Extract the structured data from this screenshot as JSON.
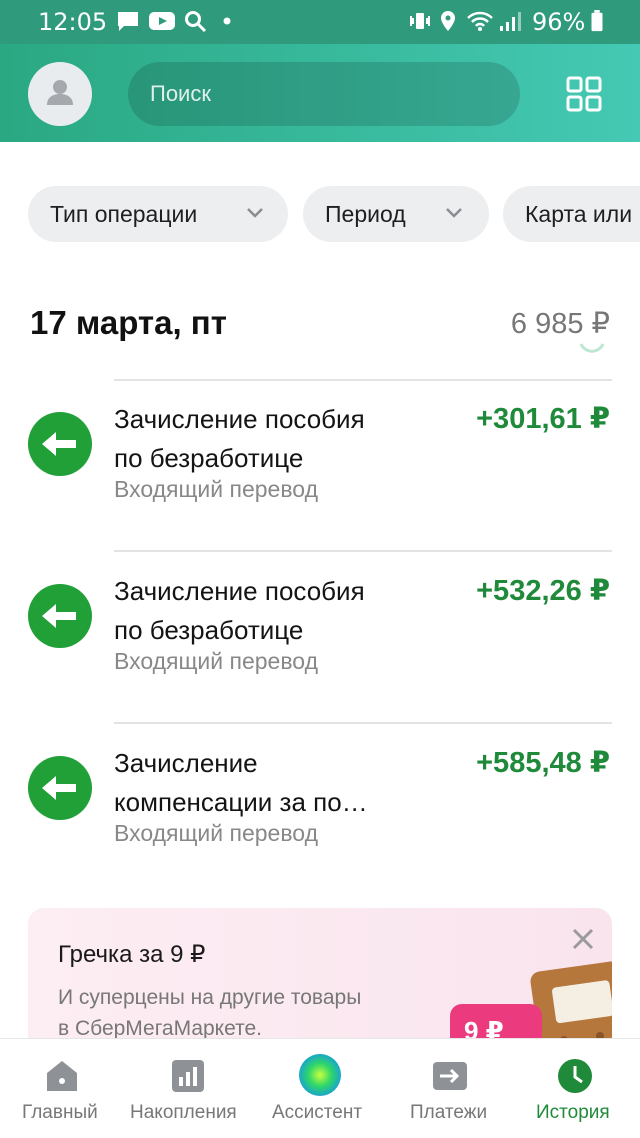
{
  "status_bar": {
    "time": "12:05",
    "battery": "96%"
  },
  "header": {
    "search_placeholder": "Поиск"
  },
  "filters": [
    {
      "label": "Тип операции"
    },
    {
      "label": "Период"
    },
    {
      "label": "Карта или"
    }
  ],
  "day": {
    "date": "17 марта, пт",
    "total": "6 985 ₽"
  },
  "transactions": [
    {
      "title_line1": "Зачисление пособия",
      "title_line2": "по безработице",
      "subtitle": "Входящий перевод",
      "amount": "+301,61 ₽"
    },
    {
      "title_line1": "Зачисление пособия",
      "title_line2": "по безработице",
      "subtitle": "Входящий перевод",
      "amount": "+532,26 ₽"
    },
    {
      "title_line1": "Зачисление",
      "title_line2": "компенсации за по…",
      "subtitle": "Входящий перевод",
      "amount": "+585,48 ₽"
    }
  ],
  "promo": {
    "title": "Гречка за 9 ₽",
    "text_line1": "И суперцены на другие товары",
    "text_line2": "в СберМегаМаркете.",
    "badge": "9 ₽"
  },
  "tabbar": [
    {
      "label": "Главный",
      "icon": "home-icon"
    },
    {
      "label": "Накопления",
      "icon": "savings-chart-icon"
    },
    {
      "label": "Ассистент",
      "icon": "assistant-orb-icon"
    },
    {
      "label": "Платежи",
      "icon": "payments-arrow-icon"
    },
    {
      "label": "История",
      "icon": "history-clock-icon",
      "active": true
    }
  ],
  "colors": {
    "brand_green": "#2aa882",
    "accent_teal": "#45c9b4",
    "income_green": "#1f8a3a",
    "promo_pink": "#ec3a7e"
  }
}
